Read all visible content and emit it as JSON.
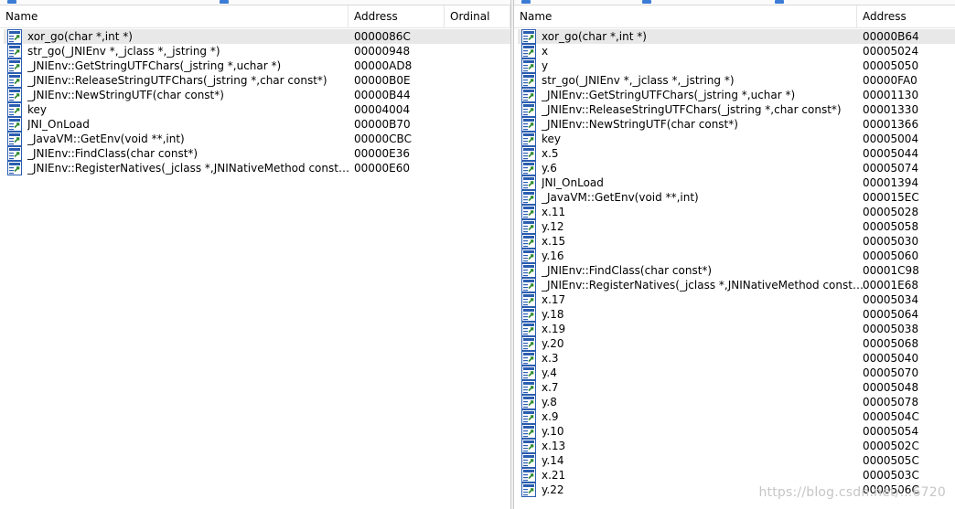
{
  "left_panel": {
    "columns": {
      "name": "Name",
      "address": "Address",
      "ordinal": "Ordinal"
    },
    "rows": [
      {
        "name": "xor_go(char *,int *)",
        "address": "0000086C",
        "selected": true
      },
      {
        "name": "str_go(_JNIEnv *,_jclass *,_jstring *)",
        "address": "00000948"
      },
      {
        "name": "_JNIEnv::GetStringUTFChars(_jstring *,uchar *)",
        "address": "00000AD8"
      },
      {
        "name": "_JNIEnv::ReleaseStringUTFChars(_jstring *,char const*)",
        "address": "00000B0E"
      },
      {
        "name": "_JNIEnv::NewStringUTF(char const*)",
        "address": "00000B44"
      },
      {
        "name": "key",
        "address": "00004004"
      },
      {
        "name": "JNI_OnLoad",
        "address": "00000B70"
      },
      {
        "name": "_JavaVM::GetEnv(void **,int)",
        "address": "00000CBC"
      },
      {
        "name": "_JNIEnv::FindClass(char const*)",
        "address": "00000E36"
      },
      {
        "name": "_JNIEnv::RegisterNatives(_jclass *,JNINativeMethod const*,...",
        "address": "00000E60"
      }
    ]
  },
  "right_panel": {
    "columns": {
      "name": "Name",
      "address": "Address"
    },
    "rows": [
      {
        "name": "xor_go(char *,int *)",
        "address": "00000B64",
        "selected": true
      },
      {
        "name": "x",
        "address": "00005024"
      },
      {
        "name": "y",
        "address": "00005050"
      },
      {
        "name": "str_go(_JNIEnv *,_jclass *,_jstring *)",
        "address": "00000FA0"
      },
      {
        "name": "_JNIEnv::GetStringUTFChars(_jstring *,uchar *)",
        "address": "00001130"
      },
      {
        "name": "_JNIEnv::ReleaseStringUTFChars(_jstring *,char const*)",
        "address": "00001330"
      },
      {
        "name": "_JNIEnv::NewStringUTF(char const*)",
        "address": "00001366"
      },
      {
        "name": "key",
        "address": "00005004"
      },
      {
        "name": "x.5",
        "address": "00005044"
      },
      {
        "name": "y.6",
        "address": "00005074"
      },
      {
        "name": "JNI_OnLoad",
        "address": "00001394"
      },
      {
        "name": "_JavaVM::GetEnv(void **,int)",
        "address": "000015EC"
      },
      {
        "name": "x.11",
        "address": "00005028"
      },
      {
        "name": "y.12",
        "address": "00005058"
      },
      {
        "name": "x.15",
        "address": "00005030"
      },
      {
        "name": "y.16",
        "address": "00005060"
      },
      {
        "name": "_JNIEnv::FindClass(char const*)",
        "address": "00001C98"
      },
      {
        "name": "_JNIEnv::RegisterNatives(_jclass *,JNINativeMethod const*,...",
        "address": "00001E68"
      },
      {
        "name": "x.17",
        "address": "00005034"
      },
      {
        "name": "y.18",
        "address": "00005064"
      },
      {
        "name": "x.19",
        "address": "00005038"
      },
      {
        "name": "y.20",
        "address": "00005068"
      },
      {
        "name": "x.3",
        "address": "00005040"
      },
      {
        "name": "y.4",
        "address": "00005070"
      },
      {
        "name": "x.7",
        "address": "00005048"
      },
      {
        "name": "y.8",
        "address": "00005078"
      },
      {
        "name": "x.9",
        "address": "0000504C"
      },
      {
        "name": "y.10",
        "address": "00005054"
      },
      {
        "name": "x.13",
        "address": "0000502C"
      },
      {
        "name": "y.14",
        "address": "0000505C"
      },
      {
        "name": "x.21",
        "address": "0000503C"
      },
      {
        "name": "y.22",
        "address": "0000506C"
      }
    ]
  },
  "icon": "export-function-icon",
  "colors": {
    "selection": "#e8e8e8",
    "icon_blue": "#2a5db0",
    "watermark": "#c6c6c6"
  },
  "watermark": "https://blog.csdn.net/...6720"
}
